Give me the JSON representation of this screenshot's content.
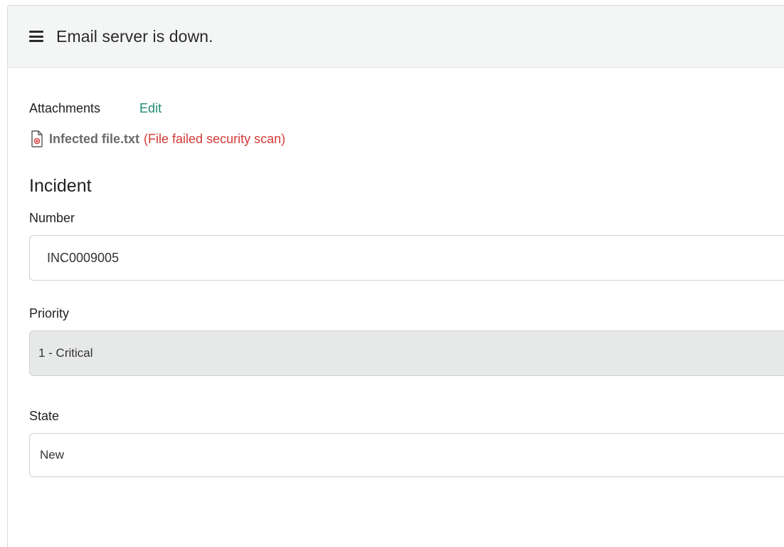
{
  "header": {
    "title": "Email server is down."
  },
  "attachments": {
    "label": "Attachments",
    "edit_label": "Edit",
    "file_name": "Infected file.txt",
    "file_error": "(File failed security scan)"
  },
  "section": {
    "title": "Incident"
  },
  "fields": {
    "number": {
      "label": "Number",
      "value": "INC0009005"
    },
    "priority": {
      "label": "Priority",
      "value": "1 - Critical"
    },
    "state": {
      "label": "State",
      "value": "New"
    }
  },
  "colors": {
    "link": "#1f8a70",
    "error": "#d43a35",
    "header_bg": "#f4f5f5",
    "readonly_bg": "#e7e8e8"
  }
}
